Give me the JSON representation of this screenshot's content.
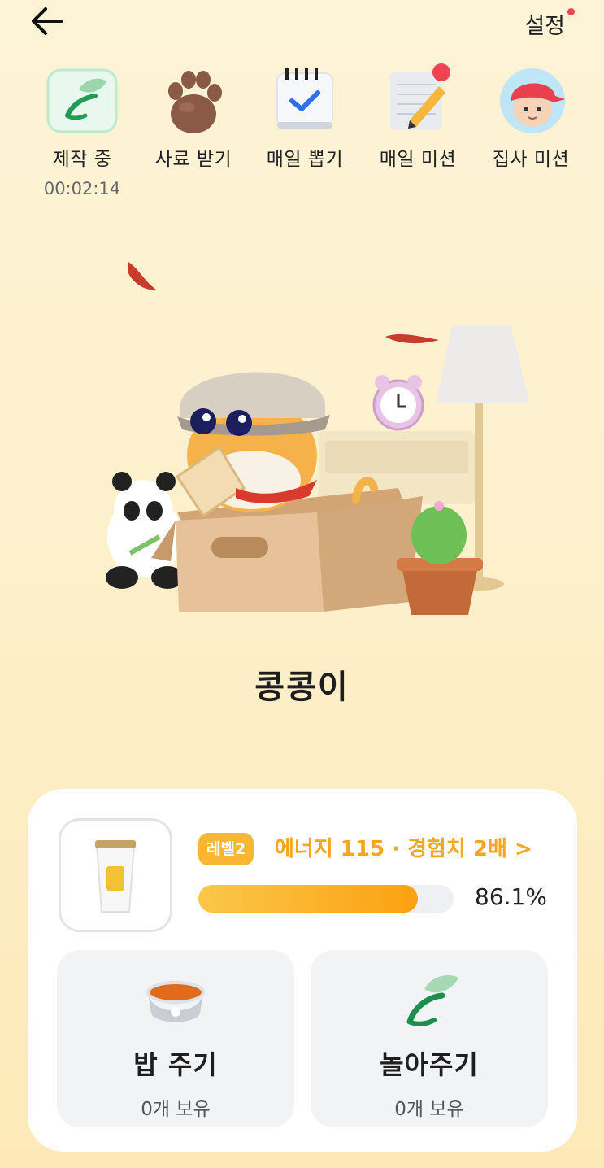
{
  "header": {
    "back_icon": "arrow-left-icon",
    "settings_label": "설정",
    "settings_has_notification": true
  },
  "quick_menu": [
    {
      "label": "제작 중",
      "sub": "00:02:14",
      "icon": "leaf-icon"
    },
    {
      "label": "사료 받기",
      "icon": "paw-icon"
    },
    {
      "label": "매일 뽑기",
      "icon": "calendar-check-icon"
    },
    {
      "label": "매일 미션",
      "icon": "notepad-pencil-icon",
      "badge": true
    },
    {
      "label": "집사 미션",
      "icon": "avatar-icon"
    }
  ],
  "pet": {
    "name": "콩콩이"
  },
  "status": {
    "level_label": "레벨2",
    "level_text": "에너지 115 · 경험치 2배 >",
    "progress_fraction": 0.861,
    "progress_percent": "86.1%",
    "item_icon": "coffee-cup-icon"
  },
  "actions": {
    "feed": {
      "title": "밥 주기",
      "sub": "0개 보유",
      "icon": "food-bowl-icon"
    },
    "play": {
      "title": "놀아주기",
      "sub": "0개 보유",
      "icon": "leaf-icon"
    }
  },
  "colors": {
    "accent": "#f5a623",
    "badge": "#f04452",
    "progress_start": "#fbc74a",
    "progress_end": "#fba111"
  }
}
